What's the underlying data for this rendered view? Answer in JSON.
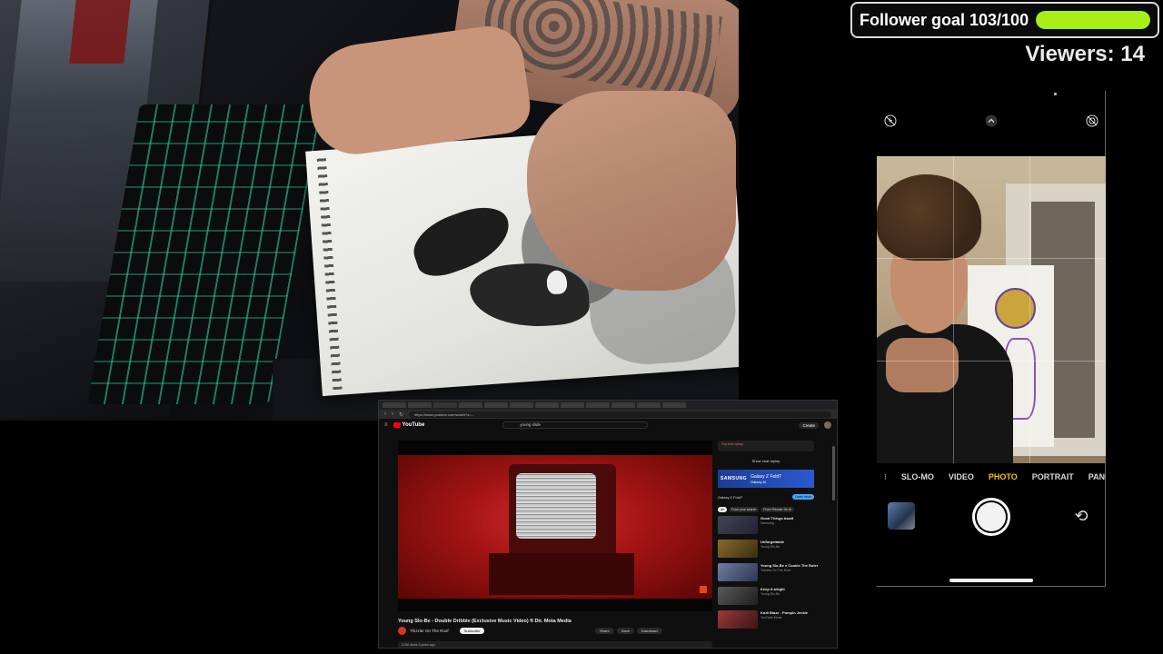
{
  "overlay": {
    "follower_goal_label": "Follower goal 103/100",
    "follower_goal_progress": 1.0,
    "viewers_label": "Viewers: 14",
    "goal_bar_color": "#a6f017"
  },
  "phone_camera": {
    "icons": {
      "flash": "flash-off-icon",
      "expand": "chevron-up-icon",
      "settings": "live-off-icon",
      "flip": "camera-flip-icon"
    },
    "modes": [
      "SLO-MO",
      "VIDEO",
      "PHOTO",
      "PORTRAIT",
      "PANO"
    ],
    "active_mode": "PHOTO"
  },
  "browser": {
    "url": "https://www.youtube.com/watch?v=...",
    "youtube": {
      "logo": "YouTube",
      "search_value": "young slide",
      "create_label": "Create",
      "video_title": "Young Slo-Be - Double Dribble (Exclusive Music Video) ft Dir. Mota Media",
      "channel_name": "Thizzler On The Roof",
      "subscribe_label": "Subscribe",
      "actions": [
        "Share",
        "Save",
        "Download"
      ],
      "description": "3.4M views  3 years ago",
      "sidebar": {
        "live_chat": "Top chat replay",
        "show_chat_replay": "Show chat replay",
        "ad_brand": "SAMSUNG",
        "ad_text": "Galaxy Z Fold7",
        "ad_subtitle": "Galaxy AI",
        "ad_name": "Galaxy Z Fold7",
        "ad_button": "Learn more",
        "chips": [
          "All",
          "From your search",
          "From Thizzler On th"
        ],
        "recommendations": [
          {
            "title": "Good Things Await",
            "channel": "Samsung"
          },
          {
            "title": "Unforgettable",
            "channel": "Young Slo-Be"
          },
          {
            "title": "Young Slo-Be x Cookie The Ruler",
            "channel": "Thizzler On The Roof"
          },
          {
            "title": "Keep it alright",
            "channel": "Young Slo-Be"
          },
          {
            "title": "Kodi Blaze - Pumpin Jeckle",
            "channel": "YouTube Music"
          }
        ]
      }
    }
  }
}
